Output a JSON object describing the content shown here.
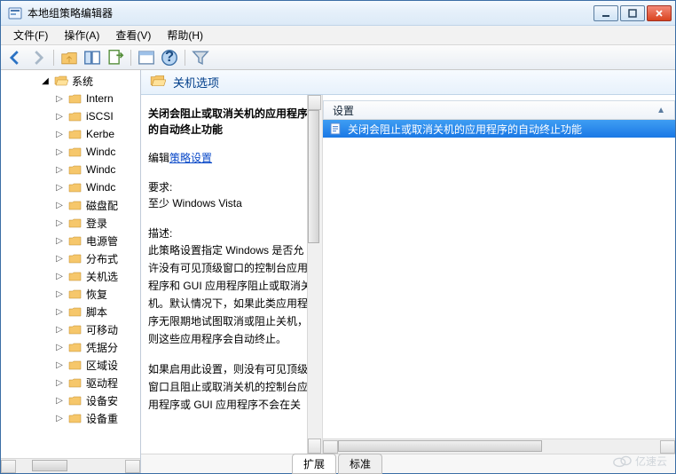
{
  "window": {
    "title": "本地组策略编辑器"
  },
  "menu": {
    "file": "文件(F)",
    "action": "操作(A)",
    "view": "查看(V)",
    "help": "帮助(H)"
  },
  "tree": {
    "root": "系统",
    "items": [
      "Intern",
      "iSCSI",
      "Kerbe",
      "Windc",
      "Windc",
      "Windc",
      "磁盘配",
      "登录",
      "电源管",
      "分布式",
      "关机选",
      "恢复",
      "脚本",
      "可移动",
      "凭据分",
      "区域设",
      "驱动程",
      "设备安",
      "设备重"
    ]
  },
  "header": {
    "title": "关机选项"
  },
  "desc": {
    "title": "关闭会阻止或取消关机的应用程序的自动终止功能",
    "edit_prefix": "编辑",
    "edit_link": "策略设置",
    "req_label": "要求:",
    "req_value": "至少 Windows Vista",
    "body_label": "描述:",
    "body1": "此策略设置指定 Windows 是否允许没有可见顶级窗口的控制台应用程序和 GUI 应用程序阻止或取消关机。默认情况下，如果此类应用程序无限期地试图取消或阻止关机，则这些应用程序会自动终止。",
    "body2": "如果启用此设置，则没有可见顶级窗口且阻止或取消关机的控制台应用程序或 GUI 应用程序不会在关"
  },
  "list": {
    "col": "设置",
    "rows": [
      "关闭会阻止或取消关机的应用程序的自动终止功能"
    ]
  },
  "tabs": {
    "ext": "扩展",
    "std": "标准"
  },
  "watermark": "亿速云"
}
